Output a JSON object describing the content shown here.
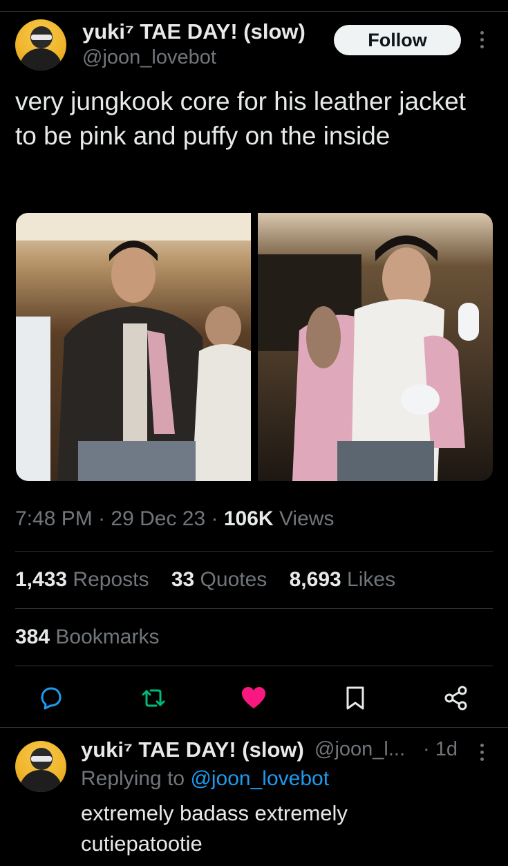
{
  "tweet": {
    "author_name": "yuki⁷ TAE DAY! (slow)",
    "author_handle": "@joon_lovebot",
    "follow_label": "Follow",
    "text": "very jungkook core for his leather jacket to be pink and puffy on the inside",
    "time": "7:48 PM",
    "date": "29 Dec 23",
    "views_count": "106K",
    "views_label": "Views",
    "separator": "·",
    "reposts_count": "1,433",
    "reposts_label": "Reposts",
    "quotes_count": "33",
    "quotes_label": "Quotes",
    "likes_count": "8,693",
    "likes_label": "Likes",
    "bookmarks_count": "384",
    "bookmarks_label": "Bookmarks",
    "liked": true
  },
  "actions": {
    "icons": [
      "reply-icon",
      "repost-icon",
      "like-icon",
      "bookmark-icon",
      "share-icon"
    ]
  },
  "reply": {
    "author_name": "yuki⁷ TAE DAY! (slow)",
    "author_handle": "@joon_l...",
    "time_ago": "· 1d",
    "replying_prefix": "Replying to",
    "replying_handle": "@joon_lovebot",
    "text": "extremely badass extremely cutiepatootie"
  },
  "colors": {
    "background": "#000000",
    "text": "#e7e9ea",
    "secondary": "#71767b",
    "accent": "#1d9bf0",
    "like": "#f91880"
  }
}
